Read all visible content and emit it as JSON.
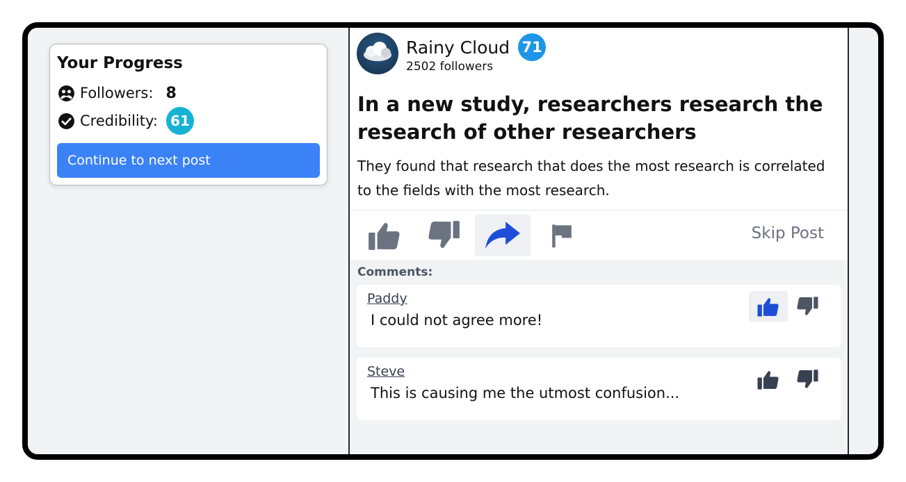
{
  "progress": {
    "title": "Your Progress",
    "followers_label": "Followers:",
    "followers_value": "8",
    "credibility_label": "Credibility:",
    "credibility_value": "61",
    "continue_label": "Continue to next post"
  },
  "post": {
    "author_name": "Rainy Cloud",
    "author_score": "71",
    "author_followers": "2502 followers",
    "headline": "In a new study, researchers research the research of other researchers",
    "body": "They found that research that does the most research is correlated to the fields with the most research.",
    "skip_label": "Skip Post",
    "comments_label": "Comments:",
    "comments": [
      {
        "author": "Paddy",
        "text": "I could not agree more!"
      },
      {
        "author": "Steve",
        "text": "This is causing me the utmost confusion..."
      }
    ]
  },
  "colors": {
    "accent_blue": "#3b82f6",
    "share_blue": "#1d4ed8",
    "credibility_badge": "#16b2d4",
    "score_badge": "#1d96e8",
    "icon_gray": "#6b7280"
  },
  "icons": {
    "followers": "people-circle-icon",
    "credibility": "check-circle-icon",
    "like": "thumbs-up-icon",
    "dislike": "thumbs-down-icon",
    "share": "share-arrow-icon",
    "flag": "flag-icon"
  }
}
